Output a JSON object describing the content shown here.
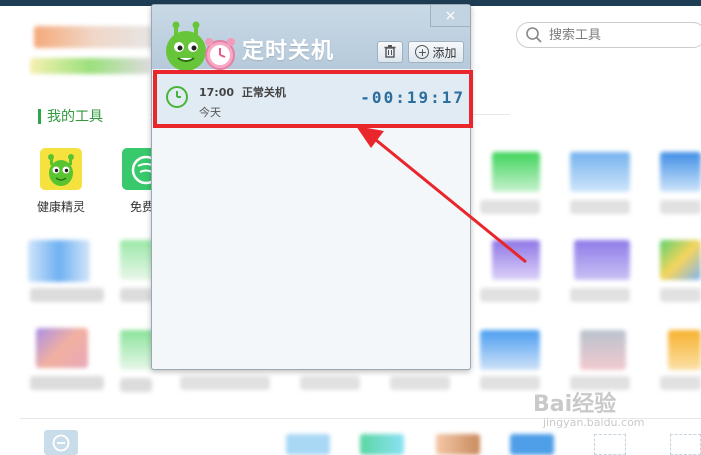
{
  "background": {
    "search": {
      "placeholder": "搜索工具"
    },
    "section_title": "我的工具",
    "tools": [
      {
        "label": "健康精灵"
      },
      {
        "label": "免费"
      }
    ]
  },
  "dialog": {
    "title": "定时关机",
    "close_label": "×",
    "delete_icon": "trash-icon",
    "add_label": "添加",
    "task": {
      "time": "17:00",
      "action": "正常关机",
      "day": "今天",
      "countdown": "-00:19:17"
    }
  },
  "watermark": {
    "main": "Bai经验",
    "sub": "jingyan.baidu.com"
  },
  "colors": {
    "accent_green": "#2ea44f",
    "highlight_red": "#e8262b",
    "countdown_blue": "#2c6e9e"
  }
}
